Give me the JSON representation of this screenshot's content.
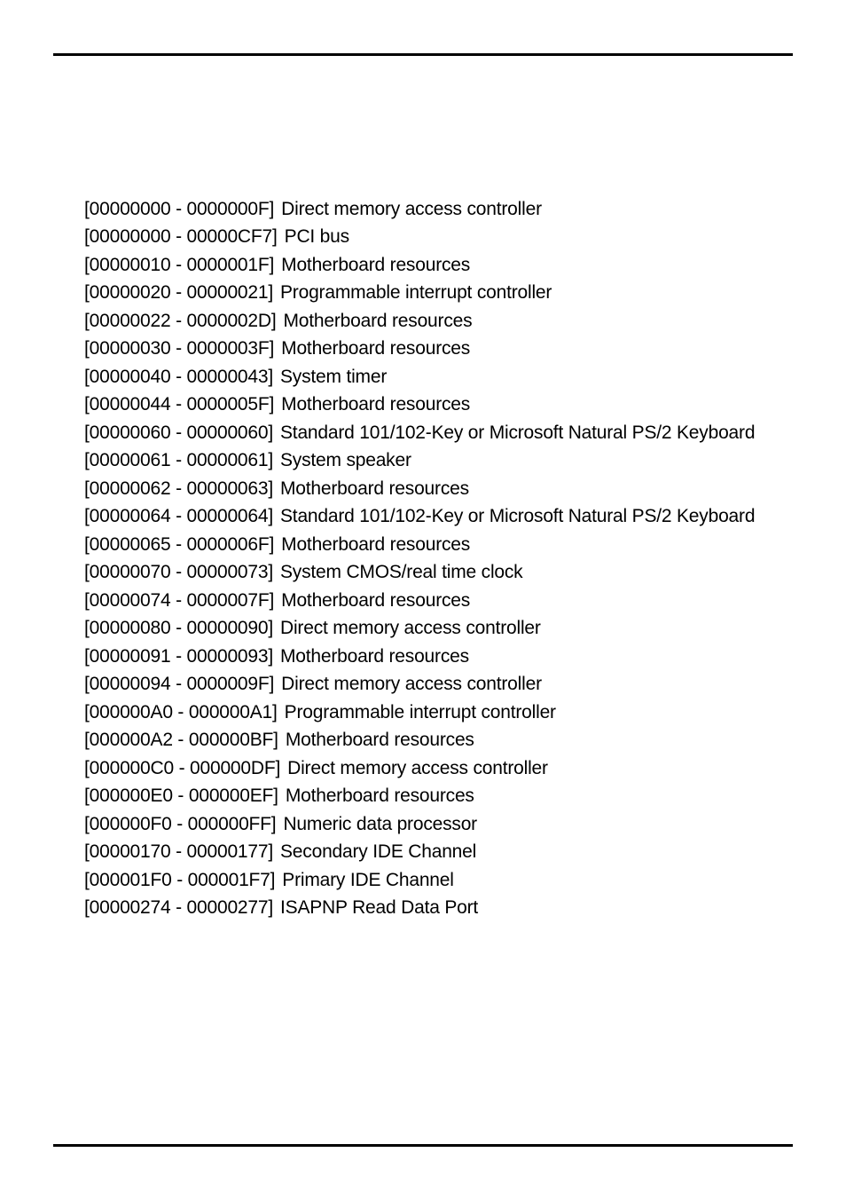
{
  "resources": [
    {
      "range": "[00000000 - 0000000F]",
      "desc": "Direct memory access controller",
      "marker": ""
    },
    {
      "range": "[00000000 - 00000CF7]",
      "desc": "PCI bus",
      "marker": ""
    },
    {
      "range": "[00000010 - 0000001F]",
      "desc": "Motherboard resources",
      "marker": ""
    },
    {
      "range": "[00000020 - 00000021]",
      "desc": "Programmable interrupt controller",
      "marker": ""
    },
    {
      "range": "[00000022 - 0000002D]",
      "desc": "Motherboard resources",
      "marker": ""
    },
    {
      "range": "[00000030 - 0000003F]",
      "desc": "Motherboard resources",
      "marker": ""
    },
    {
      "range": "[00000040 - 00000043]",
      "desc": "System timer",
      "marker": ""
    },
    {
      "range": "[00000044 - 0000005F]",
      "desc": "Motherboard resources",
      "marker": ""
    },
    {
      "range": "[00000060 - 00000060]",
      "desc": "Standard 101/102-Key or Microsoft Natural PS/2 Keyboard",
      "marker": ""
    },
    {
      "range": "[00000061 - 00000061]",
      "desc": "System speaker",
      "marker": ""
    },
    {
      "range": "[00000062 - 00000063]",
      "desc": "Motherboard resources",
      "marker": ""
    },
    {
      "range": "[00000064 - 00000064]",
      "desc": "Standard 101/102-Key or Microsoft Natural PS/2 Keyboard",
      "marker": ""
    },
    {
      "range": "[00000065 - 0000006F]",
      "desc": "Motherboard resources",
      "marker": ""
    },
    {
      "range": "[00000070 - 00000073]",
      "desc": "System CMOS/real time clock",
      "marker": ""
    },
    {
      "range": "[00000074 - 0000007F]",
      "desc": "Motherboard resources",
      "marker": ""
    },
    {
      "range": "[00000080 - 00000090]",
      "desc": "Direct memory access controller",
      "marker": ""
    },
    {
      "range": "[00000091 - 00000093]",
      "desc": "Motherboard resources",
      "marker": ""
    },
    {
      "range": "[00000094 - 0000009F]",
      "desc": "Direct memory access controller",
      "marker": ""
    },
    {
      "range": "[000000A0 - 000000A1]",
      "desc": "Programmable interrupt controller",
      "marker": ""
    },
    {
      "range": "[000000A2 - 000000BF]",
      "desc": "Motherboard resources",
      "marker": ""
    },
    {
      "range": "[000000C0 - 000000DF]",
      "desc": "Direct memory access controller",
      "marker": ""
    },
    {
      "range": "[000000E0 - 000000EF]",
      "desc": "Motherboard resources",
      "marker": ""
    },
    {
      "range": "[000000F0 - 000000FF]",
      "desc": "Numeric data processor",
      "marker": ""
    },
    {
      "range": "[00000170 - 00000177]",
      "desc": "Secondary IDE Channel",
      "marker": ""
    },
    {
      "range": "[000001F0 - 000001F7]",
      "desc": "Primary IDE Channel",
      "marker": ""
    },
    {
      "range": "[00000274 - 00000277]",
      "desc": "ISAPNP Read Data Port",
      "marker": ""
    }
  ]
}
